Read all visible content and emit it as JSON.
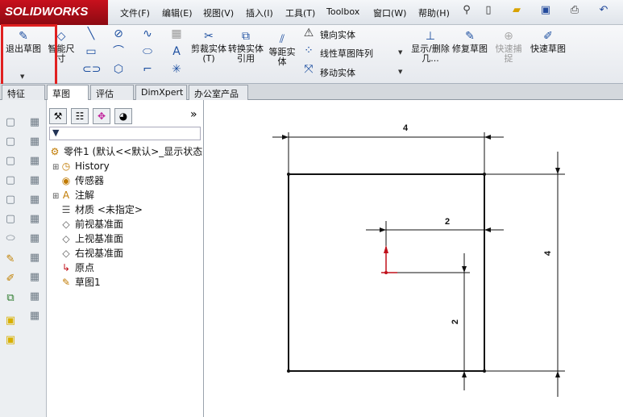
{
  "app": {
    "logo": "SOLIDWORKS"
  },
  "menu": [
    "文件(F)",
    "编辑(E)",
    "视图(V)",
    "插入(I)",
    "工具(T)",
    "Toolbox",
    "窗口(W)",
    "帮助(H)"
  ],
  "ribbon": {
    "exit_sketch": "退出草图",
    "smart_dim": "智能尺寸",
    "trim": "剪裁实体(T)",
    "convert": "转换实体引用",
    "offset": "等距实体",
    "mirror": "镜向实体",
    "linear_pattern": "线性草图阵列",
    "move": "移动实体",
    "display_delete": "显示/删除几...",
    "repair": "修复草图",
    "quick_snap": "快速捕捉",
    "rapid_sketch": "快速草图"
  },
  "tabs": [
    "特征",
    "草图",
    "评估",
    "DimXpert",
    "办公室产品"
  ],
  "active_tab": "草图",
  "tree": {
    "root": "零件1 (默认<<默认>_显示状态",
    "items": [
      {
        "label": "History",
        "icon": "history-icon",
        "expandable": true
      },
      {
        "label": "传感器",
        "icon": "sensor-icon",
        "expandable": false
      },
      {
        "label": "注解",
        "icon": "annotation-icon",
        "expandable": true
      },
      {
        "label": "材质 <未指定>",
        "icon": "material-icon",
        "expandable": false
      },
      {
        "label": "前视基准面",
        "icon": "plane-icon",
        "expandable": false
      },
      {
        "label": "上视基准面",
        "icon": "plane-icon",
        "expandable": false
      },
      {
        "label": "右视基准面",
        "icon": "plane-icon",
        "expandable": false
      },
      {
        "label": "原点",
        "icon": "origin-icon",
        "expandable": false
      },
      {
        "label": "草图1",
        "icon": "sketch-icon",
        "expandable": false
      }
    ],
    "more": "»"
  },
  "sketch": {
    "dim_top": "4",
    "dim_inner_h": "2",
    "dim_right": "4",
    "dim_inner_v": "2"
  },
  "colors": {
    "highlight": "#e02020",
    "origin": "#c0101a"
  }
}
